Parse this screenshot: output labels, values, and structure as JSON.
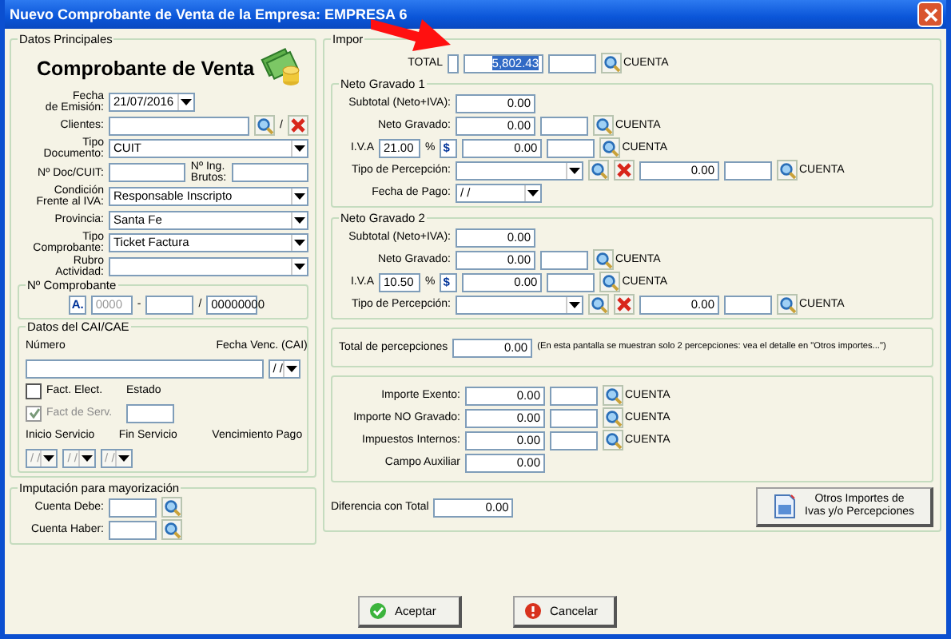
{
  "window": {
    "title": "Nuevo Comprobante de Venta de la Empresa: EMPRESA 6"
  },
  "left": [
    {
      "kind": "group",
      "title": "Datos Principales",
      "blocks": [
        {
          "kind": "heading",
          "text": "Comprobante de Venta"
        },
        {
          "kind": "row",
          "items": [
            {
              "kind": "lead",
              "text": "Fecha\nde Emisión:"
            },
            {
              "kind": "date",
              "value": "21/07/2016"
            }
          ]
        },
        {
          "kind": "row",
          "items": [
            {
              "kind": "lead",
              "text": "Clientes:"
            },
            {
              "kind": "input"
            },
            {
              "kind": "search"
            },
            {
              "kind": "text",
              "text": "/"
            },
            {
              "kind": "clear"
            }
          ]
        },
        {
          "kind": "row",
          "items": [
            {
              "kind": "lead",
              "text": "Tipo\nDocumento:"
            },
            {
              "kind": "combo",
              "value": "CUIT"
            }
          ]
        },
        {
          "kind": "row",
          "items": [
            {
              "kind": "lead",
              "text": "Nº Doc/CUIT:"
            },
            {
              "kind": "input"
            },
            {
              "kind": "text",
              "text": "Nº Ing.\nBrutos:"
            },
            {
              "kind": "input"
            }
          ]
        },
        {
          "kind": "row",
          "items": [
            {
              "kind": "lead",
              "text": "Condición\nFrente al IVA:"
            },
            {
              "kind": "combo",
              "value": "Responsable Inscripto"
            }
          ]
        },
        {
          "kind": "row",
          "items": [
            {
              "kind": "lead",
              "text": "Provincia:"
            },
            {
              "kind": "combo",
              "value": "Santa Fe"
            }
          ]
        },
        {
          "kind": "row",
          "items": [
            {
              "kind": "lead",
              "text": "Tipo\nComprobante:"
            },
            {
              "kind": "combo",
              "value": "Ticket Factura"
            }
          ]
        },
        {
          "kind": "row",
          "items": [
            {
              "kind": "lead",
              "text": "Rubro\nActividad:"
            },
            {
              "kind": "combo"
            }
          ]
        },
        {
          "kind": "group",
          "title": "Nº Comprobante",
          "blocks": [
            {
              "kind": "row",
              "items": [
                {
                  "kind": "letter",
                  "text": "A."
                },
                {
                  "kind": "code",
                  "value": "0000",
                  "disabled": true
                },
                {
                  "kind": "text",
                  "text": "-"
                },
                {
                  "kind": "field"
                },
                {
                  "kind": "text",
                  "text": "/"
                },
                {
                  "kind": "code",
                  "value": "00000000",
                  "disabled": false
                }
              ]
            }
          ]
        },
        {
          "kind": "group",
          "title": "Datos del CAI/CAE",
          "blocks": [
            {
              "kind": "cols",
              "items": [
                {
                  "kind": "caption",
                  "text": "Número"
                },
                {
                  "kind": "caption",
                  "text": "Fecha Venc. (CAI)"
                }
              ]
            },
            {
              "kind": "cols",
              "items": [
                {
                  "kind": "input"
                },
                {
                  "kind": "date",
                  "value": "/ /",
                  "disabled": false
                }
              ]
            },
            {
              "kind": "row",
              "items": [
                {
                  "kind": "check",
                  "text": "Fact. Elect.",
                  "checked": false,
                  "disabled": false
                },
                {
                  "kind": "caption",
                  "text": "Estado"
                }
              ]
            },
            {
              "kind": "row",
              "items": [
                {
                  "kind": "check",
                  "text": "Fact de Serv.",
                  "checked": true,
                  "disabled": true
                },
                {
                  "kind": "field"
                }
              ]
            },
            {
              "kind": "cols",
              "items": [
                {
                  "kind": "caption",
                  "text": "Inicio Servicio"
                },
                {
                  "kind": "caption",
                  "text": "Fin Servicio"
                },
                {
                  "kind": "caption",
                  "text": "Vencimiento Pago"
                }
              ]
            },
            {
              "kind": "cols",
              "items": [
                {
                  "kind": "date",
                  "value": "/ /",
                  "disabled": true
                },
                {
                  "kind": "date",
                  "value": "/ /",
                  "disabled": true
                },
                {
                  "kind": "date",
                  "value": "/ /",
                  "disabled": true
                }
              ]
            }
          ]
        }
      ]
    },
    {
      "kind": "group",
      "title": "Imputación para mayorización",
      "blocks": [
        {
          "kind": "row",
          "items": [
            {
              "kind": "lead",
              "text": "Cuenta Debe:"
            },
            {
              "kind": "field"
            },
            {
              "kind": "search"
            }
          ]
        },
        {
          "kind": "row",
          "items": [
            {
              "kind": "lead",
              "text": "Cuenta Haber:"
            },
            {
              "kind": "field"
            },
            {
              "kind": "search"
            }
          ]
        }
      ]
    }
  ],
  "right": [
    {
      "kind": "group",
      "title": "Impor",
      "blocks": [
        {
          "kind": "row",
          "items": [
            {
              "kind": "lead",
              "text": "TOTAL"
            },
            {
              "kind": "stub"
            },
            {
              "kind": "amount",
              "value": "5,802.43",
              "selected": true
            },
            {
              "kind": "field"
            },
            {
              "kind": "search"
            },
            {
              "kind": "tag",
              "text": "CUENTA"
            }
          ]
        },
        {
          "kind": "group",
          "title": "Neto Gravado 1",
          "blocks": [
            {
              "kind": "row",
              "items": [
                {
                  "kind": "lead",
                  "text": "Subtotal (Neto+IVA):"
                },
                {
                  "kind": "amount",
                  "value": "0.00",
                  "selected": false
                }
              ]
            },
            {
              "kind": "row",
              "items": [
                {
                  "kind": "lead",
                  "text": "Neto Gravado:"
                },
                {
                  "kind": "amount",
                  "value": "0.00",
                  "selected": false
                },
                {
                  "kind": "field"
                },
                {
                  "kind": "search"
                },
                {
                  "kind": "tag",
                  "text": "CUENTA"
                }
              ]
            },
            {
              "kind": "row",
              "items": [
                {
                  "kind": "short",
                  "text": "I.V.A"
                },
                {
                  "kind": "percent",
                  "value": "21.00"
                },
                {
                  "kind": "text",
                  "text": "%"
                },
                {
                  "kind": "letter",
                  "text": "$"
                },
                {
                  "kind": "amount",
                  "value": "0.00",
                  "selected": false
                },
                {
                  "kind": "field"
                },
                {
                  "kind": "search"
                },
                {
                  "kind": "tag",
                  "text": "CUENTA"
                }
              ]
            },
            {
              "kind": "row",
              "items": [
                {
                  "kind": "lead",
                  "text": "Tipo de Percepción:"
                },
                {
                  "kind": "select"
                },
                {
                  "kind": "search"
                },
                {
                  "kind": "clear"
                },
                {
                  "kind": "amount",
                  "value": "0.00",
                  "selected": false
                },
                {
                  "kind": "field"
                },
                {
                  "kind": "search"
                },
                {
                  "kind": "tag",
                  "text": "CUENTA"
                }
              ]
            },
            {
              "kind": "row",
              "items": [
                {
                  "kind": "lead",
                  "text": "Fecha de Pago:"
                },
                {
                  "kind": "date",
                  "value": "/ /",
                  "disabled": false
                }
              ]
            }
          ]
        },
        {
          "kind": "group",
          "title": "Neto Gravado 2",
          "blocks": [
            {
              "kind": "row",
              "items": [
                {
                  "kind": "lead",
                  "text": "Subtotal (Neto+IVA):"
                },
                {
                  "kind": "amount",
                  "value": "0.00",
                  "selected": false
                }
              ]
            },
            {
              "kind": "row",
              "items": [
                {
                  "kind": "lead",
                  "text": "Neto Gravado:"
                },
                {
                  "kind": "amount",
                  "value": "0.00",
                  "selected": false
                },
                {
                  "kind": "field"
                },
                {
                  "kind": "search"
                },
                {
                  "kind": "tag",
                  "text": "CUENTA"
                }
              ]
            },
            {
              "kind": "row",
              "items": [
                {
                  "kind": "short",
                  "text": "I.V.A"
                },
                {
                  "kind": "percent",
                  "value": "10.50"
                },
                {
                  "kind": "text",
                  "text": "%"
                },
                {
                  "kind": "letter",
                  "text": "$"
                },
                {
                  "kind": "amount",
                  "value": "0.00",
                  "selected": false
                },
                {
                  "kind": "field"
                },
                {
                  "kind": "search"
                },
                {
                  "kind": "tag",
                  "text": "CUENTA"
                }
              ]
            },
            {
              "kind": "row",
              "items": [
                {
                  "kind": "lead",
                  "text": "Tipo de Percepción:"
                },
                {
                  "kind": "select"
                },
                {
                  "kind": "search"
                },
                {
                  "kind": "clear"
                },
                {
                  "kind": "amount",
                  "value": "0.00",
                  "selected": false
                },
                {
                  "kind": "field"
                },
                {
                  "kind": "search"
                },
                {
                  "kind": "tag",
                  "text": "CUENTA"
                }
              ]
            }
          ]
        },
        {
          "kind": "box",
          "blocks": [
            {
              "kind": "row",
              "items": [
                {
                  "kind": "text",
                  "text": "Total de percepciones"
                },
                {
                  "kind": "amount",
                  "value": "0.00",
                  "selected": false
                },
                {
                  "kind": "note",
                  "text": "(En esta pantalla se muestran solo 2 percepciones: vea el  detalle en \"Otros importes...\")"
                }
              ]
            }
          ]
        },
        {
          "kind": "box",
          "blocks": [
            {
              "kind": "row",
              "items": [
                {
                  "kind": "lead",
                  "text": "Importe Exento:"
                },
                {
                  "kind": "amount",
                  "value": "0.00",
                  "selected": false
                },
                {
                  "kind": "field"
                },
                {
                  "kind": "search"
                },
                {
                  "kind": "tag",
                  "text": "CUENTA"
                }
              ]
            },
            {
              "kind": "row",
              "items": [
                {
                  "kind": "lead",
                  "text": "Importe NO Gravado:"
                },
                {
                  "kind": "amount",
                  "value": "0.00",
                  "selected": false
                },
                {
                  "kind": "field"
                },
                {
                  "kind": "search"
                },
                {
                  "kind": "tag",
                  "text": "CUENTA"
                }
              ]
            },
            {
              "kind": "row",
              "items": [
                {
                  "kind": "lead",
                  "text": "Impuestos Internos:"
                },
                {
                  "kind": "amount",
                  "value": "0.00",
                  "selected": false
                },
                {
                  "kind": "field"
                },
                {
                  "kind": "search"
                },
                {
                  "kind": "tag",
                  "text": "CUENTA"
                }
              ]
            },
            {
              "kind": "row",
              "items": [
                {
                  "kind": "lead",
                  "text": "Campo Auxiliar"
                },
                {
                  "kind": "amount",
                  "value": "0.00",
                  "selected": false
                }
              ]
            }
          ]
        },
        {
          "kind": "row",
          "items": [
            {
              "kind": "text",
              "text": "Diferencia con Total"
            },
            {
              "kind": "amount",
              "value": "0.00",
              "selected": false
            },
            {
              "kind": "button",
              "text": "Otros Importes de\nIvas y/o Percepciones"
            }
          ]
        }
      ]
    }
  ],
  "buttons": [
    {
      "kind": "ok",
      "label": "Aceptar"
    },
    {
      "kind": "cancel",
      "label": "Cancelar"
    }
  ]
}
